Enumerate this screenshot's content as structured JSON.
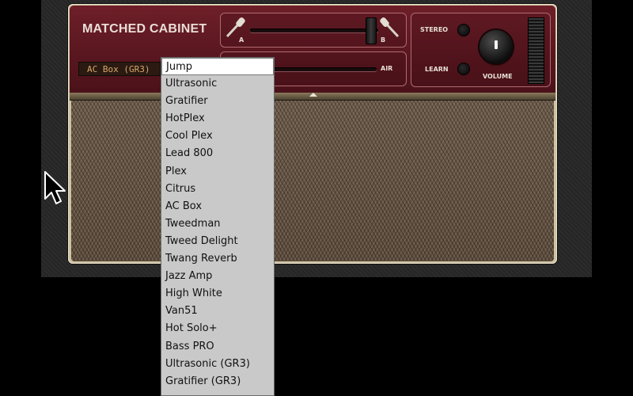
{
  "plugin": {
    "title": "MATCHED CABINET",
    "preset_value": "AC Box (GR3)"
  },
  "mic_section": {
    "label_a": "A",
    "label_b": "B",
    "air_label": "AIR"
  },
  "controls": {
    "stereo_label": "STEREO",
    "learn_label": "LEARN",
    "volume_label": "VOLUME"
  },
  "dropdown": {
    "selected_index": 0,
    "options": [
      "Jump",
      "Ultrasonic",
      "Gratifier",
      "HotPlex",
      "Cool Plex",
      "Lead 800",
      "Plex",
      "Citrus",
      "AC Box",
      "Tweedman",
      "Tweed Delight",
      "Twang Reverb",
      "Jazz Amp",
      "High White",
      "Van51",
      "Hot Solo+",
      "Bass PRO",
      "Ultrasonic (GR3)",
      "Gratifier (GR3)"
    ]
  },
  "icons": {
    "mic_a": "microphone-icon",
    "mic_b": "microphone-icon",
    "cursor": "mouse-pointer-icon"
  },
  "colors": {
    "panel": "#5a1720",
    "text_light": "#eaded6",
    "preset_text": "#d8a766",
    "dropdown_bg": "#c9c9c9"
  }
}
